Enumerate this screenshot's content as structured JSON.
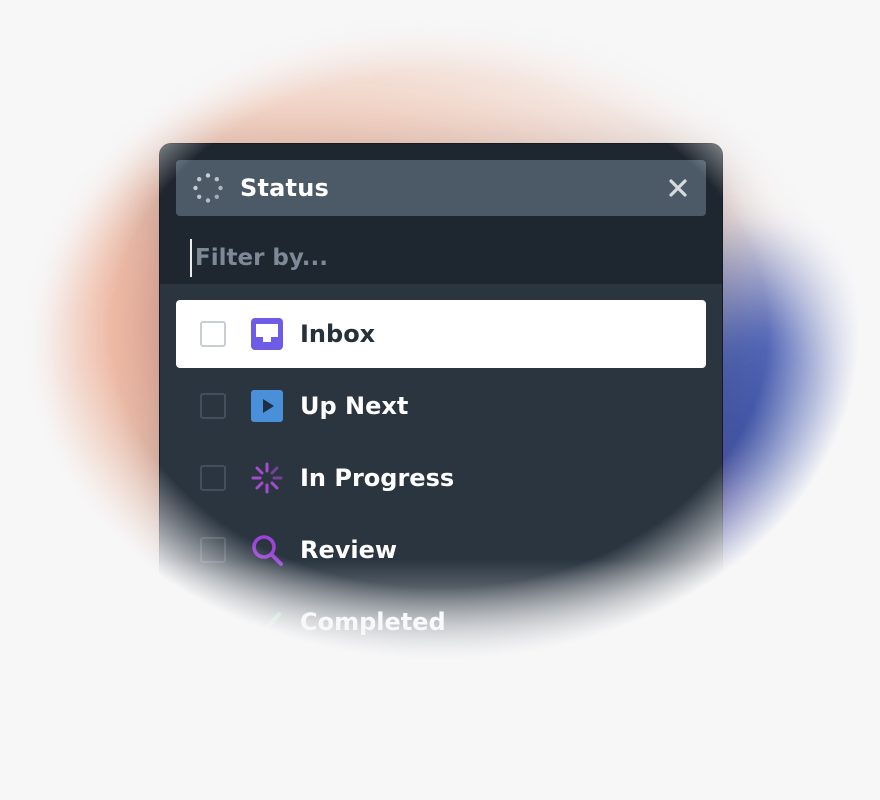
{
  "filter": {
    "chip_label": "Status",
    "placeholder": "Filter by..."
  },
  "icons": {
    "chip": "status-spinner-icon",
    "close": "close-icon"
  },
  "items": [
    {
      "label": "Inbox",
      "icon": "inbox-icon",
      "color": "#6e5ce6",
      "active": true,
      "checked": false
    },
    {
      "label": "Up Next",
      "icon": "play-icon",
      "color": "#4a8fd9",
      "active": false,
      "checked": false
    },
    {
      "label": "In Progress",
      "icon": "in-progress-icon",
      "color": "#a24ccf",
      "active": false,
      "checked": false
    },
    {
      "label": "Review",
      "icon": "search-icon",
      "color": "#9b44d6",
      "active": false,
      "checked": false
    },
    {
      "label": "Completed",
      "icon": "check-icon",
      "color": "#3aa56b",
      "active": false,
      "checked": false
    }
  ],
  "colors": {
    "panel": "#2a3540",
    "header": "#1e262f",
    "chip": "#4c5a68",
    "active_row": "#ffffff"
  }
}
